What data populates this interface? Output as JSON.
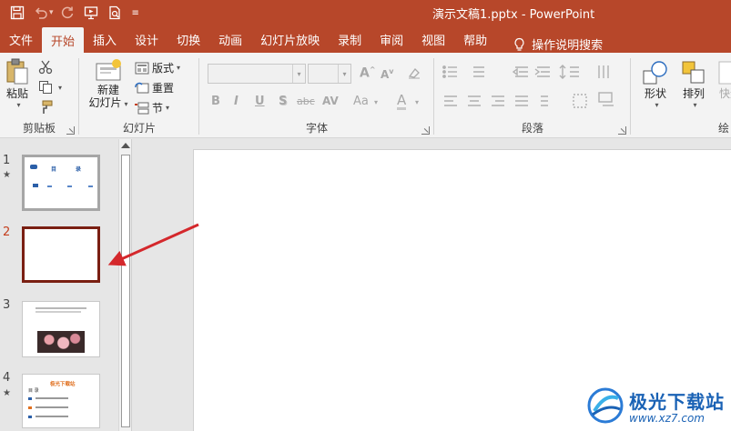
{
  "window": {
    "title": "演示文稿1.pptx  -  PowerPoint"
  },
  "qat": {
    "save": "save-icon",
    "undo": "undo-icon",
    "redo": "redo-icon",
    "from_start": "present-from-start-icon",
    "preview": "print-preview-icon"
  },
  "tabs": [
    {
      "label": "文件"
    },
    {
      "label": "开始",
      "active": true
    },
    {
      "label": "插入"
    },
    {
      "label": "设计"
    },
    {
      "label": "切换"
    },
    {
      "label": "动画"
    },
    {
      "label": "幻灯片放映"
    },
    {
      "label": "录制"
    },
    {
      "label": "审阅"
    },
    {
      "label": "视图"
    },
    {
      "label": "帮助"
    }
  ],
  "tell_me": {
    "label": "操作说明搜索"
  },
  "ribbon": {
    "clipboard": {
      "label": "剪贴板",
      "paste": "粘贴"
    },
    "slides": {
      "label": "幻灯片",
      "new_slide_line1": "新建",
      "new_slide_line2": "幻灯片",
      "layout": "版式",
      "reset": "重置",
      "section": "节"
    },
    "font": {
      "label": "字体",
      "bold": "B",
      "italic": "I",
      "underline": "U",
      "shadow": "S",
      "strike": "abc",
      "spacing": "AV",
      "case": "Aa",
      "color": "A",
      "grow": "A",
      "shrink": "A"
    },
    "paragraph": {
      "label": "段落"
    },
    "drawing": {
      "shapes": "形状",
      "arrange": "排列",
      "quick_styles": "快速",
      "label_partial": "绘"
    }
  },
  "slides": [
    {
      "number": "1",
      "has_animation": true,
      "content": {
        "title_left": "目",
        "title_right": "录"
      }
    },
    {
      "number": "2",
      "has_animation": false,
      "selected": true
    },
    {
      "number": "3",
      "has_animation": false
    },
    {
      "number": "4",
      "has_animation": true,
      "content": {
        "title": "极光下载站",
        "heading": "目 录"
      }
    }
  ],
  "watermark": {
    "name": "极光下载站",
    "url": "www.xz7.com"
  },
  "colors": {
    "accent": "#b7472a",
    "selected_slide_border": "#7a1f12",
    "arrow": "#d4282c"
  }
}
